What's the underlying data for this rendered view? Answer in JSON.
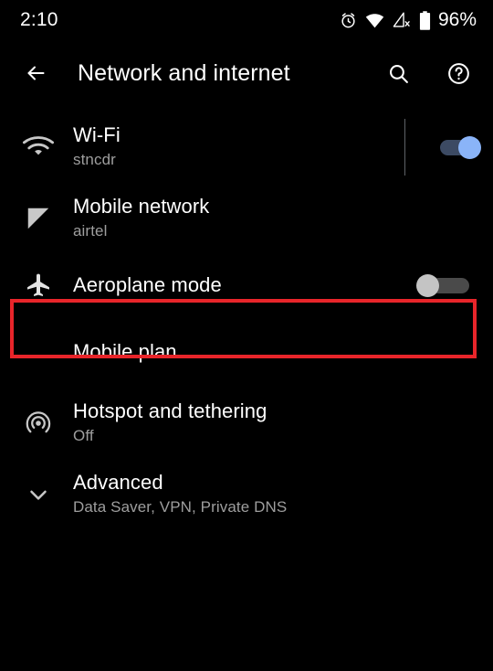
{
  "status_bar": {
    "time": "2:10",
    "battery_percent": "96%",
    "icons": [
      "alarm-icon",
      "wifi-icon",
      "cellular-signal-off-icon",
      "battery-icon"
    ]
  },
  "app_bar": {
    "back_label": "back-arrow",
    "title": "Network and internet",
    "search_label": "search-icon",
    "help_label": "help-icon"
  },
  "colors": {
    "background": "#000000",
    "title_text": "#ffffff",
    "subtitle_text": "#9e9e9e",
    "icon": "#c8c8c8",
    "switch_on_thumb": "#8ab4f8",
    "switch_on_track": "#3c4a63",
    "switch_off_thumb": "#c4c4c4",
    "switch_off_track": "#4a4a4a",
    "highlight_border": "#e8252a"
  },
  "settings_list": [
    {
      "icon": "wifi-icon",
      "title": "Wi-Fi",
      "subtitle": "stncdr",
      "has_divider": true,
      "switch": "on"
    },
    {
      "icon": "cellular-signal-icon",
      "title": "Mobile network",
      "subtitle": "airtel",
      "has_divider": false,
      "switch": "none"
    },
    {
      "icon": "airplane-icon",
      "title": "Aeroplane mode",
      "subtitle": "",
      "has_divider": false,
      "switch": "off",
      "highlighted": true
    },
    {
      "icon": "none",
      "title": "Mobile plan",
      "subtitle": "",
      "has_divider": false,
      "switch": "none"
    },
    {
      "icon": "hotspot-icon",
      "title": "Hotspot and tethering",
      "subtitle": "Off",
      "has_divider": false,
      "switch": "none"
    },
    {
      "icon": "chevron-down-icon",
      "title": "Advanced",
      "subtitle": "Data Saver, VPN, Private DNS",
      "has_divider": false,
      "switch": "none"
    }
  ]
}
